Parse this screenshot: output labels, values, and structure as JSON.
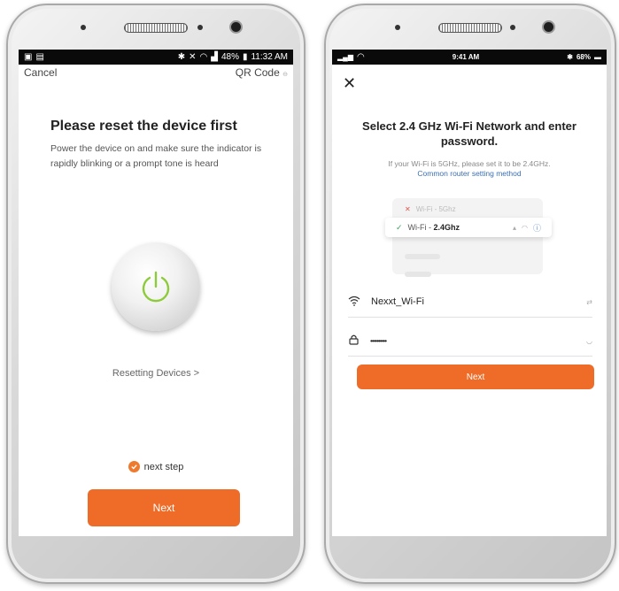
{
  "left": {
    "status": {
      "time": "11:32 AM",
      "battery": "48%"
    },
    "header": {
      "cancel": "Cancel",
      "qr": "QR Code"
    },
    "title": "Please reset the device first",
    "description": "Power the device on and make sure the indicator is rapidly blinking or a prompt tone is heard",
    "reset_link": "Resetting Devices >",
    "next_step": "next step",
    "next_button": "Next"
  },
  "right": {
    "status": {
      "time": "9:41 AM",
      "battery": "68%"
    },
    "close": "✕",
    "title": "Select 2.4 GHz Wi-Fi Network and enter password.",
    "hint": "If your Wi-Fi is 5GHz, please set it to be 2.4GHz.",
    "hint_link": "Common router setting method",
    "illustration": {
      "row1_prefix": "Wi-Fi - ",
      "row1": "5Ghz",
      "row2_prefix": "Wi-Fi - ",
      "row2": "2.4Ghz"
    },
    "ssid": "Nexxt_Wi-Fi",
    "password_mask": "••••••••••",
    "next_button": "Next"
  },
  "colors": {
    "accent": "#ee6c27",
    "power_icon": "#8ecb3b",
    "link": "#3a6fb5"
  }
}
